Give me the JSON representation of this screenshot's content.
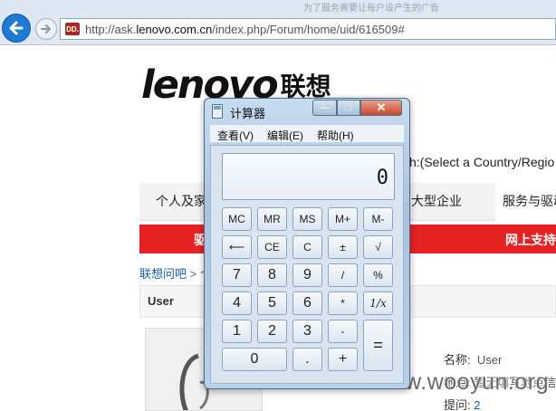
{
  "browser": {
    "url_prefix": "http://ask.",
    "url_domain": "lenovo.com.cn",
    "url_path": "/index.php/Forum/home/uid/616509#",
    "favicon_text": "DD.",
    "ghost_text": "为了服务需要让每户设产生的广告"
  },
  "site": {
    "logo_latin": "lenovo",
    "logo_cn": "联想",
    "country_select": "sh:(Select a Country/Regio",
    "nav": [
      "个人及家",
      "大型企业",
      "服务与驱动"
    ],
    "redbar": [
      "驱",
      "网上支持"
    ],
    "breadcrumb": "联想问吧",
    "breadcrumb_sep": " > 个",
    "user_title": "User",
    "info": {
      "name_label": "名称:",
      "name_value": "User",
      "location_label": "地点:",
      "location_value": "暂无填写地点信息",
      "questions_label": "提问:",
      "questions_value": "2"
    },
    "watermark": "www.wooyun.org"
  },
  "calculator": {
    "title": "计算器",
    "menu": [
      "查看(V)",
      "编辑(E)",
      "帮助(H)"
    ],
    "display": "0",
    "window_buttons": {
      "min": "—",
      "max": "□",
      "close": "✕"
    },
    "keys": {
      "mc": "MC",
      "mr": "MR",
      "ms": "MS",
      "mplus": "M+",
      "mminus": "M-",
      "back": "⟵",
      "ce": "CE",
      "c": "C",
      "plusminus": "±",
      "sqrt": "√",
      "k7": "7",
      "k8": "8",
      "k9": "9",
      "div": "/",
      "pct": "%",
      "k4": "4",
      "k5": "5",
      "k6": "6",
      "mul": "*",
      "recip": "1/x",
      "k1": "1",
      "k2": "2",
      "k3": "3",
      "sub": "-",
      "eq": "=",
      "k0": "0",
      "dot": ".",
      "add": "+"
    }
  }
}
